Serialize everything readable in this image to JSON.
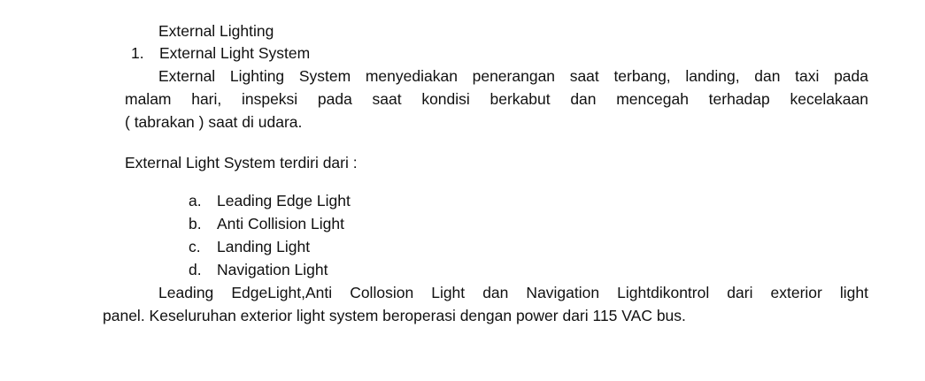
{
  "document": {
    "section_title": "External Lighting",
    "subsection": {
      "number": "1.",
      "title": "External Light System"
    },
    "paragraph1_lines": [
      "External Lighting System menyediakan penerangan saat terbang, landing, dan taxi pada",
      "malam hari, inspeksi pada saat kondisi berkabut dan mencegah terhadap kecelakaan",
      "( tabrakan ) saat di udara."
    ],
    "list_intro": "External Light System terdiri dari :",
    "list_items": [
      {
        "marker": "a.",
        "label": "Leading Edge Light"
      },
      {
        "marker": "b.",
        "label": "Anti Collision Light"
      },
      {
        "marker": "c.",
        "label": "Landing Light"
      },
      {
        "marker": "d.",
        "label": "Navigation Light"
      }
    ],
    "paragraph2_lines": [
      "Leading EdgeLight,Anti Collosion Light dan Navigation Lightdikontrol dari exterior light",
      "panel. Keseluruhan exterior light system beroperasi dengan power dari 115 VAC bus."
    ]
  }
}
